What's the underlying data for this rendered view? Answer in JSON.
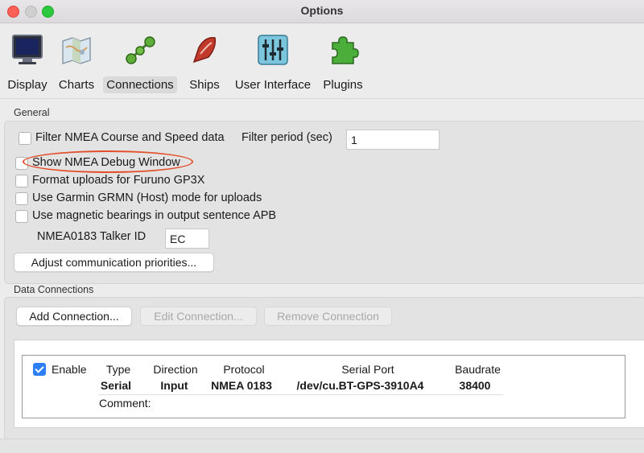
{
  "window": {
    "title": "Options"
  },
  "toolbar": {
    "items": [
      {
        "label": "Display",
        "icon": "monitor-icon"
      },
      {
        "label": "Charts",
        "icon": "charts-map-icon"
      },
      {
        "label": "Connections",
        "icon": "connections-nodes-icon"
      },
      {
        "label": "Ships",
        "icon": "ship-icon"
      },
      {
        "label": "User Interface",
        "icon": "sliders-icon"
      },
      {
        "label": "Plugins",
        "icon": "puzzle-icon"
      }
    ],
    "active": "Connections"
  },
  "general": {
    "section_label": "General",
    "filter_nmea": {
      "label": "Filter NMEA Course and Speed data",
      "checked": false
    },
    "filter_period": {
      "label": "Filter period (sec)",
      "value": "1"
    },
    "show_debug": {
      "label": "Show NMEA Debug Window",
      "checked": false
    },
    "format_furuno": {
      "label": "Format uploads for Furuno GP3X",
      "checked": false
    },
    "garmin_host": {
      "label": "Use Garmin GRMN (Host) mode for uploads",
      "checked": false
    },
    "magnetic_apb": {
      "label": "Use magnetic bearings in output sentence APB",
      "checked": false
    },
    "talker_id": {
      "label": "NMEA0183 Talker ID",
      "value": "EC"
    },
    "adjust_priorities_button": "Adjust communication priorities..."
  },
  "data_connections": {
    "section_label": "Data Connections",
    "add_button": "Add Connection...",
    "edit_button": "Edit Connection...",
    "remove_button": "Remove Connection",
    "connection": {
      "enable_label": "Enable",
      "enabled": true,
      "headers": {
        "type": "Type",
        "direction": "Direction",
        "protocol": "Protocol",
        "serial_port": "Serial Port",
        "baudrate": "Baudrate"
      },
      "values": {
        "type": "Serial",
        "direction": "Input",
        "protocol": "NMEA 0183",
        "serial_port": "/dev/cu.BT-GPS-3910A4",
        "baudrate": "38400"
      },
      "comment_label": "Comment:"
    }
  },
  "colors": {
    "accent": "#2d7ff9",
    "highlight_ellipse": "#e3512c",
    "close": "#fe5f57",
    "maximize": "#2bc840"
  }
}
